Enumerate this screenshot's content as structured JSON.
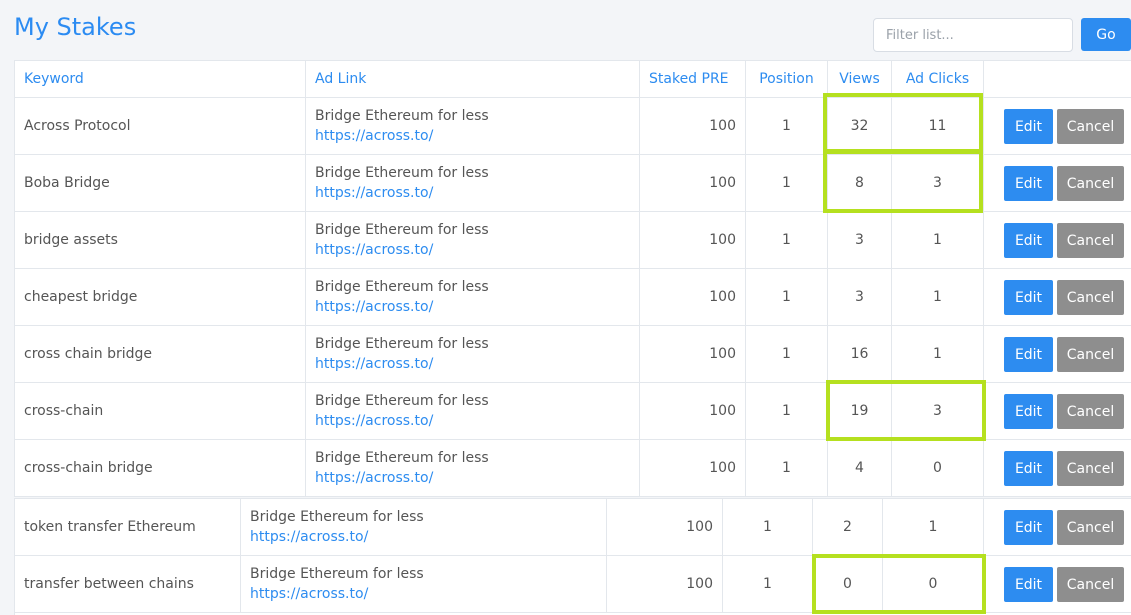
{
  "page_title": "My Stakes",
  "filter": {
    "placeholder": "Filter list...",
    "go_label": "Go"
  },
  "columns": {
    "keyword": "Keyword",
    "ad_link": "Ad Link",
    "staked": "Staked PRE",
    "position": "Position",
    "views": "Views",
    "clicks": "Ad Clicks"
  },
  "actions": {
    "edit": "Edit",
    "cancel": "Cancel"
  },
  "rows": [
    {
      "keyword": "Across Protocol",
      "ad_title": "Bridge Ethereum for less",
      "ad_url": "https://across.to/",
      "staked": "100",
      "position": "1",
      "views": "32",
      "clicks": "11"
    },
    {
      "keyword": "Boba Bridge",
      "ad_title": "Bridge Ethereum for less",
      "ad_url": "https://across.to/",
      "staked": "100",
      "position": "1",
      "views": "8",
      "clicks": "3"
    },
    {
      "keyword": "bridge assets",
      "ad_title": "Bridge Ethereum for less",
      "ad_url": "https://across.to/",
      "staked": "100",
      "position": "1",
      "views": "3",
      "clicks": "1"
    },
    {
      "keyword": "cheapest bridge",
      "ad_title": "Bridge Ethereum for less",
      "ad_url": "https://across.to/",
      "staked": "100",
      "position": "1",
      "views": "3",
      "clicks": "1"
    },
    {
      "keyword": "cross chain bridge",
      "ad_title": "Bridge Ethereum for less",
      "ad_url": "https://across.to/",
      "staked": "100",
      "position": "1",
      "views": "16",
      "clicks": "1"
    },
    {
      "keyword": "cross-chain",
      "ad_title": "Bridge Ethereum for less",
      "ad_url": "https://across.to/",
      "staked": "100",
      "position": "1",
      "views": "19",
      "clicks": "3"
    },
    {
      "keyword": "cross-chain bridge",
      "ad_title": "Bridge Ethereum for less",
      "ad_url": "https://across.to/",
      "staked": "100",
      "position": "1",
      "views": "4",
      "clicks": "0"
    }
  ],
  "rows_bottom": [
    {
      "keyword": "token transfer Ethereum",
      "ad_title": "Bridge Ethereum for less",
      "ad_url": "https://across.to/",
      "staked": "100",
      "position": "1",
      "views": "2",
      "clicks": "1"
    },
    {
      "keyword": "transfer between chains",
      "ad_title": "Bridge Ethereum for less",
      "ad_url": "https://across.to/",
      "staked": "100",
      "position": "1",
      "views": "0",
      "clicks": "0"
    }
  ],
  "highlight_color": "#b5e01f",
  "accent_color": "#2d8cf0"
}
